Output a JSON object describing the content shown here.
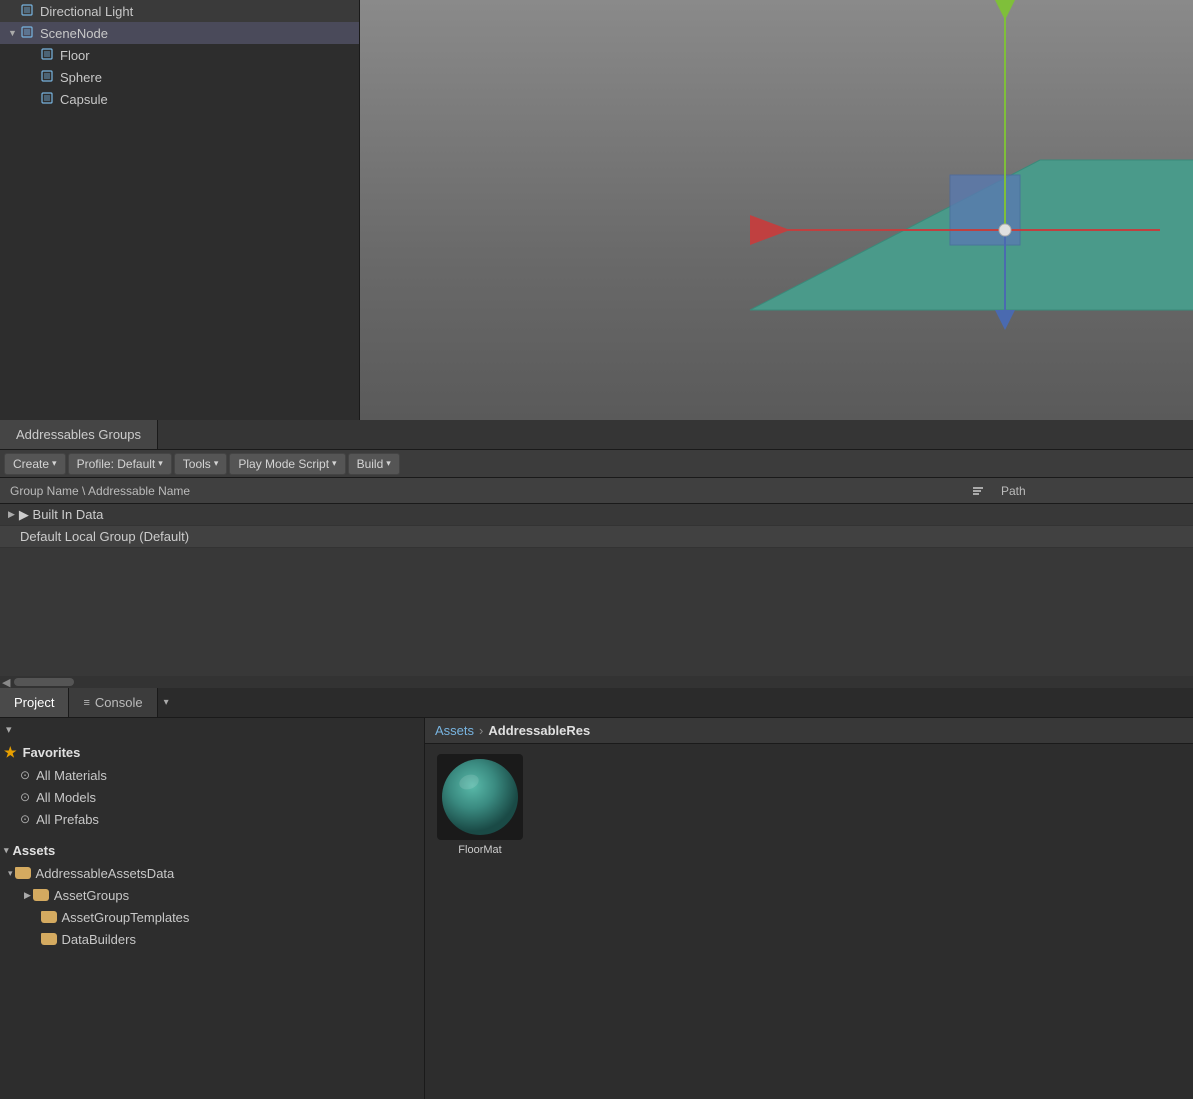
{
  "hierarchy": {
    "items": [
      {
        "label": "Directional Light",
        "indent": 0,
        "arrow": "",
        "hasArrow": false
      },
      {
        "label": "SceneNode",
        "indent": 0,
        "arrow": "▼",
        "hasArrow": true,
        "selected": true
      },
      {
        "label": "Floor",
        "indent": 1,
        "arrow": "",
        "hasArrow": false
      },
      {
        "label": "Sphere",
        "indent": 1,
        "arrow": "",
        "hasArrow": false
      },
      {
        "label": "Capsule",
        "indent": 1,
        "arrow": "",
        "hasArrow": false
      }
    ]
  },
  "addressables": {
    "tab_label": "Addressables Groups",
    "toolbar": {
      "create_label": "Create",
      "profile_label": "Profile: Default",
      "tools_label": "Tools",
      "play_mode_label": "Play Mode Script",
      "build_label": "Build"
    },
    "columns": {
      "name": "Group Name \\ Addressable Name",
      "path": "Path"
    },
    "rows": [
      {
        "label": "▶ Built In Data",
        "type": "group",
        "indent": 0
      },
      {
        "label": "Default Local Group (Default)",
        "type": "group",
        "indent": 1
      }
    ]
  },
  "bottom_tabs": [
    {
      "label": "Project",
      "icon": "",
      "active": true
    },
    {
      "label": "Console",
      "icon": "≡",
      "active": false
    }
  ],
  "project": {
    "dropdown_label": "▾",
    "favorites": {
      "header": "Favorites",
      "items": [
        {
          "label": "All Materials"
        },
        {
          "label": "All Models"
        },
        {
          "label": "All Prefabs"
        }
      ]
    },
    "assets": {
      "header": "Assets",
      "items": [
        {
          "label": "AddressableAssetsData",
          "indent": 0,
          "hasArrow": true,
          "arrowOpen": true
        },
        {
          "label": "AssetGroups",
          "indent": 1,
          "hasArrow": true,
          "arrowOpen": false
        },
        {
          "label": "AssetGroupTemplates",
          "indent": 1,
          "hasArrow": false
        },
        {
          "label": "DataBuilders",
          "indent": 1,
          "hasArrow": false
        }
      ]
    }
  },
  "breadcrumb": {
    "root": "Assets",
    "arrow": "›",
    "current": "AddressableRes"
  },
  "assets_content": [
    {
      "label": "FloorMat",
      "type": "material"
    }
  ]
}
